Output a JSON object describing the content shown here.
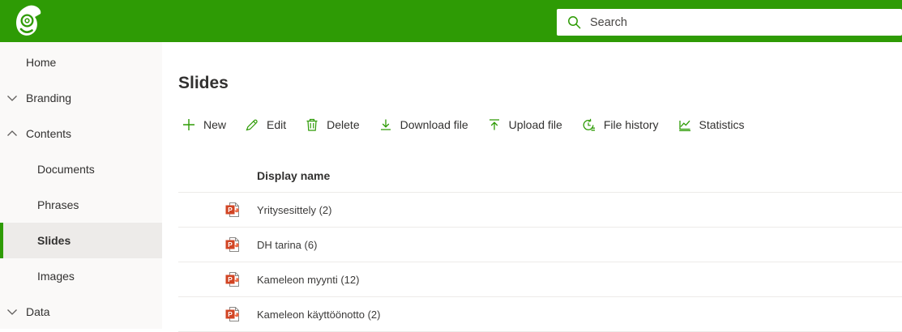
{
  "header": {
    "search_placeholder": "Search"
  },
  "sidebar": {
    "items": [
      {
        "label": "Home",
        "chevron": "none",
        "indent": false,
        "selected": false
      },
      {
        "label": "Branding",
        "chevron": "down",
        "indent": false,
        "selected": false
      },
      {
        "label": "Contents",
        "chevron": "up",
        "indent": false,
        "selected": false
      },
      {
        "label": "Documents",
        "chevron": "none",
        "indent": true,
        "selected": false
      },
      {
        "label": "Phrases",
        "chevron": "none",
        "indent": true,
        "selected": false
      },
      {
        "label": "Slides",
        "chevron": "none",
        "indent": true,
        "selected": true
      },
      {
        "label": "Images",
        "chevron": "none",
        "indent": true,
        "selected": false
      },
      {
        "label": "Data",
        "chevron": "down",
        "indent": false,
        "selected": false
      }
    ]
  },
  "main": {
    "title": "Slides",
    "toolbar": {
      "buttons": [
        {
          "label": "New",
          "icon": "plus-icon"
        },
        {
          "label": "Edit",
          "icon": "pencil-icon"
        },
        {
          "label": "Delete",
          "icon": "trash-icon"
        },
        {
          "label": "Download file",
          "icon": "download-icon"
        },
        {
          "label": "Upload file",
          "icon": "upload-icon"
        },
        {
          "label": "File history",
          "icon": "file-history-icon"
        },
        {
          "label": "Statistics",
          "icon": "statistics-icon"
        }
      ]
    },
    "table": {
      "columns": [
        "Display name"
      ],
      "rows": [
        {
          "name": "Yritysesittely (2)",
          "file_type": "powerpoint"
        },
        {
          "name": "DH tarina (6)",
          "file_type": "powerpoint"
        },
        {
          "name": "Kameleon myynti (12)",
          "file_type": "powerpoint"
        },
        {
          "name": "Kameleon käyttöönotto (2)",
          "file_type": "powerpoint"
        }
      ]
    }
  },
  "colors": {
    "accent_green": "#2E9B05",
    "sidebar_bg": "#FAF9F8",
    "selected_bg": "#EDEBE9",
    "divider": "#EDEBE9",
    "text_primary": "#323130",
    "text_secondary": "#605E5C",
    "powerpoint_red": "#D14524"
  }
}
